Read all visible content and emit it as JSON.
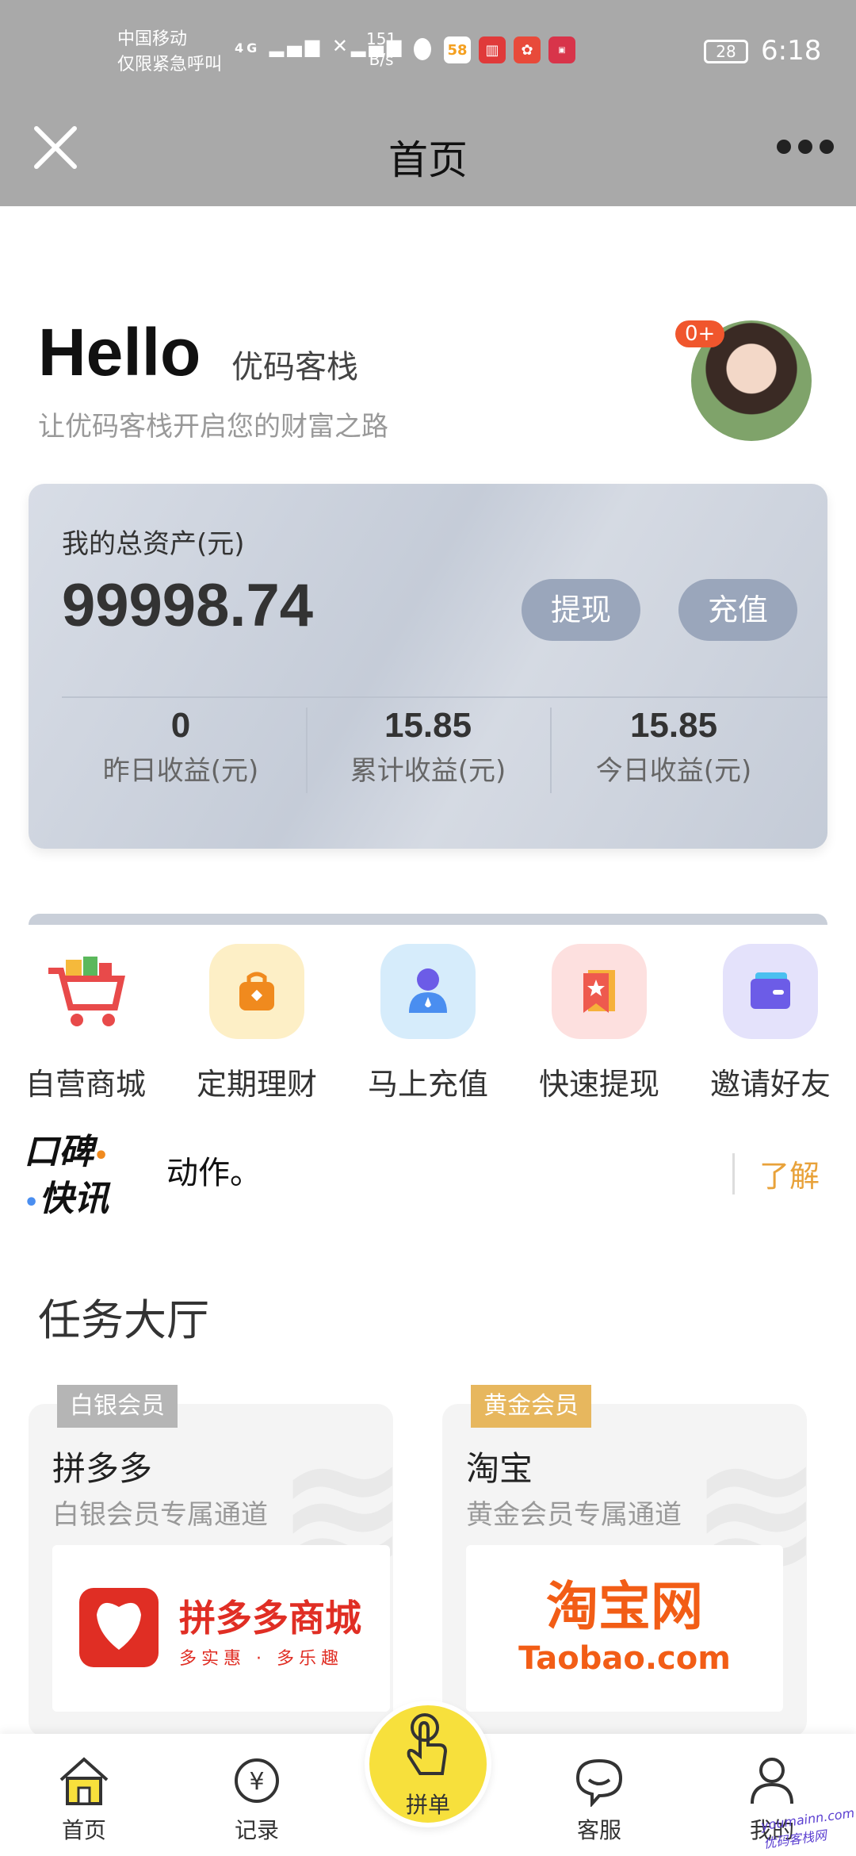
{
  "status_bar": {
    "carrier_line1": "中国移动",
    "carrier_line2": "仅限紧急呼叫",
    "network": "4G",
    "speed_value": "151",
    "speed_unit": "B/s",
    "battery": "28",
    "time": "6:18",
    "app_icons": [
      "qq-icon",
      "58-app-icon",
      "reader-app-icon",
      "lotus-app-icon",
      "mall-app-icon"
    ]
  },
  "nav": {
    "title": "首页",
    "close_icon": "close-icon",
    "more_icon": "more-icon"
  },
  "greeting": {
    "hello": "Hello",
    "brand": "优码客栈",
    "slogan": "让优码客栈开启您的财富之路",
    "avatar_badge": "0+"
  },
  "assets": {
    "label": "我的总资产(元)",
    "total": "99998.74",
    "withdraw_label": "提现",
    "recharge_label": "充值",
    "stats": [
      {
        "value": "0",
        "label": "昨日收益(元)"
      },
      {
        "value": "15.85",
        "label": "累计收益(元)"
      },
      {
        "value": "15.85",
        "label": "今日收益(元)"
      }
    ]
  },
  "quick_menu": [
    {
      "label": "自营商城",
      "icon": "shopping-cart-icon",
      "color": "#e84a4a"
    },
    {
      "label": "定期理财",
      "icon": "bag-icon",
      "color": "#f08a1e"
    },
    {
      "label": "马上充值",
      "icon": "person-icon",
      "color": "#4a6ef0"
    },
    {
      "label": "快速提现",
      "icon": "bookmark-star-icon",
      "color": "#ee5a4e"
    },
    {
      "label": "邀请好友",
      "icon": "wallet-icon",
      "color": "#6c5ce7"
    }
  ],
  "news": {
    "logo_line1": "口碑",
    "logo_line2": "快讯",
    "text": "动作。",
    "more": "了解"
  },
  "task_hall": {
    "title": "任务大厅",
    "cards": [
      {
        "badge": "白银会员",
        "name": "拼多多",
        "subtitle": "白银会员专属通道",
        "logo_title": "拼多多商城",
        "logo_slogan": "多实惠 · 多乐趣"
      },
      {
        "badge": "黄金会员",
        "name": "淘宝",
        "subtitle": "黄金会员专属通道",
        "logo_title": "淘宝网",
        "logo_slogan": "Taobao.com"
      }
    ]
  },
  "tabbar": {
    "tabs": [
      {
        "label": "首页",
        "icon": "home-icon"
      },
      {
        "label": "记录",
        "icon": "yuan-record-icon"
      },
      {
        "label": "拼单",
        "icon": "tap-hand-icon"
      },
      {
        "label": "客服",
        "icon": "chat-bubble-icon"
      },
      {
        "label": "我的",
        "icon": "user-icon"
      }
    ]
  },
  "corner_watermark": {
    "line1": "youmainn.com",
    "line2": "优码客栈网"
  },
  "colors": {
    "accent_yellow": "#f7e03c",
    "news_more": "#e8a23a",
    "silver_badge": "#b5b5b5",
    "gold_badge": "#e7b75e"
  }
}
